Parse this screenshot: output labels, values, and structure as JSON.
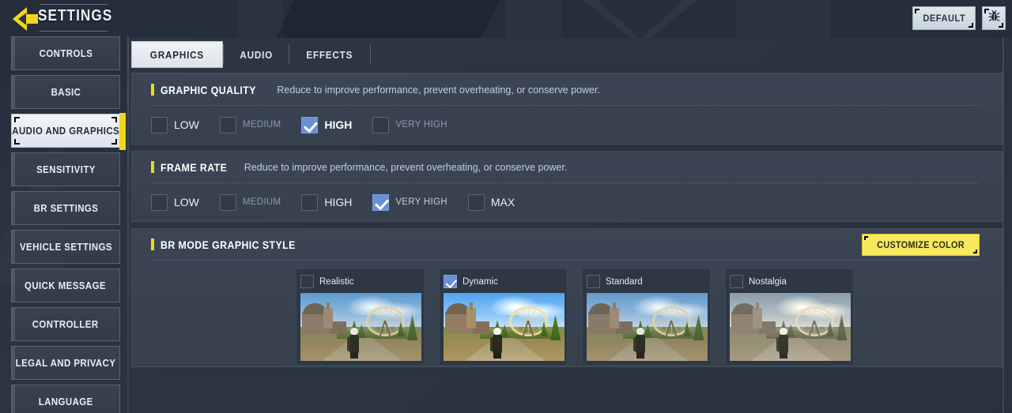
{
  "header": {
    "back_icon": "back-arrow-icon",
    "title": "SETTINGS",
    "default_label": "DEFAULT",
    "bug_icon": "bug-icon"
  },
  "sidebar": {
    "items": [
      {
        "label": "CONTROLS",
        "active": false
      },
      {
        "label": "BASIC",
        "active": false
      },
      {
        "label": "AUDIO AND GRAPHICS",
        "active": true
      },
      {
        "label": "SENSITIVITY",
        "active": false
      },
      {
        "label": "BR SETTINGS",
        "active": false
      },
      {
        "label": "VEHICLE SETTINGS",
        "active": false
      },
      {
        "label": "QUICK MESSAGE",
        "active": false
      },
      {
        "label": "CONTROLLER",
        "active": false
      },
      {
        "label": "LEGAL AND PRIVACY",
        "active": false
      },
      {
        "label": "LANGUAGE",
        "active": false
      }
    ]
  },
  "tabs": [
    {
      "label": "GRAPHICS",
      "active": true
    },
    {
      "label": "AUDIO",
      "active": false
    },
    {
      "label": "EFFECTS",
      "active": false
    }
  ],
  "sections": {
    "graphic_quality": {
      "title": "GRAPHIC QUALITY",
      "subtitle": "Reduce to improve performance, prevent overheating, or conserve power.",
      "options": [
        {
          "label": "LOW",
          "checked": false,
          "dim": false
        },
        {
          "label": "MEDIUM",
          "checked": false,
          "dim": true
        },
        {
          "label": "HIGH",
          "checked": true,
          "dim": false
        },
        {
          "label": "VERY HIGH",
          "checked": false,
          "dim": true
        }
      ]
    },
    "frame_rate": {
      "title": "FRAME RATE",
      "subtitle": "Reduce to improve performance, prevent overheating, or conserve power.",
      "options": [
        {
          "label": "LOW",
          "checked": false,
          "dim": false
        },
        {
          "label": "MEDIUM",
          "checked": false,
          "dim": true
        },
        {
          "label": "HIGH",
          "checked": false,
          "dim": false
        },
        {
          "label": "VERY HIGH",
          "checked": true,
          "dim": true
        },
        {
          "label": "MAX",
          "checked": false,
          "dim": false
        }
      ]
    },
    "br_mode_graphic_style": {
      "title": "BR MODE GRAPHIC STYLE",
      "customize_color_label": "CUSTOMIZE COLOR",
      "styles": [
        {
          "label": "Realistic",
          "checked": false,
          "tone": "realistic"
        },
        {
          "label": "Dynamic",
          "checked": true,
          "tone": "dynamic"
        },
        {
          "label": "Standard",
          "checked": false,
          "tone": "standard"
        },
        {
          "label": "Nostalgia",
          "checked": false,
          "tone": "nostalgia"
        }
      ]
    }
  },
  "colors": {
    "accent_yellow": "#f2d718",
    "checkbox_blue": "#6b8fd4",
    "panel_bg": "#3b4553",
    "page_bg": "#2b3441",
    "customize_btn": "#f7e85c"
  }
}
